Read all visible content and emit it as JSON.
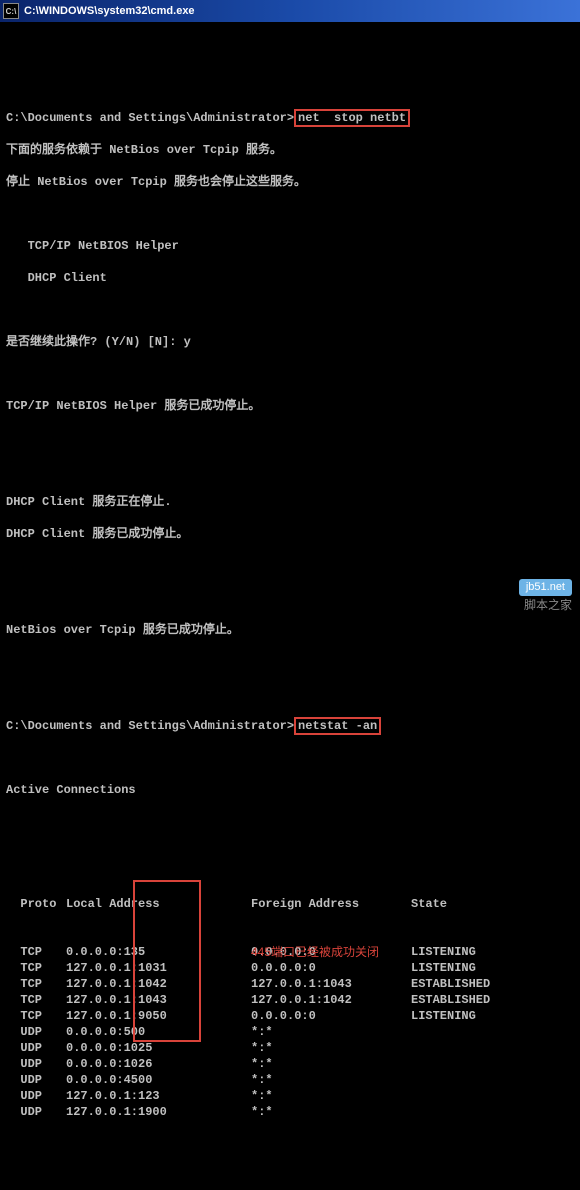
{
  "window": {
    "title": "C:\\WINDOWS\\system32\\cmd.exe",
    "icon_name": "cmd-icon",
    "icon_glyph": "C:\\"
  },
  "lines": {
    "blank": " ",
    "prompt1_path": "C:\\Documents and Settings\\Administrator>",
    "prompt1_cmd": "net  stop netbt",
    "l2": "下面的服务依赖于 NetBios over Tcpip 服务。",
    "l3": "停止 NetBios over Tcpip 服务也会停止这些服务。",
    "l4": "   TCP/IP NetBIOS Helper",
    "l5": "   DHCP Client",
    "l6": "是否继续此操作? (Y/N) [N]: y",
    "l7": "TCP/IP NetBIOS Helper 服务已成功停止。",
    "l8": "DHCP Client 服务正在停止.",
    "l9": "DHCP Client 服务已成功停止。",
    "l10": "NetBios over Tcpip 服务已成功停止。",
    "prompt2_path": "C:\\Documents and Settings\\Administrator>",
    "prompt2_cmd": "netstat -an",
    "l11": "Active Connections",
    "hdr_proto": "Proto",
    "hdr_local": "Local Address",
    "hdr_foreign": "Foreign Address",
    "hdr_state": "State"
  },
  "connections": [
    {
      "proto": "TCP",
      "local": "0.0.0.0:135",
      "foreign": "0.0.0.0:0",
      "state": "LISTENING"
    },
    {
      "proto": "TCP",
      "local": "127.0.0.1:1031",
      "foreign": "0.0.0.0:0",
      "state": "LISTENING"
    },
    {
      "proto": "TCP",
      "local": "127.0.0.1:1042",
      "foreign": "127.0.0.1:1043",
      "state": "ESTABLISHED"
    },
    {
      "proto": "TCP",
      "local": "127.0.0.1:1043",
      "foreign": "127.0.0.1:1042",
      "state": "ESTABLISHED"
    },
    {
      "proto": "TCP",
      "local": "127.0.0.1:9050",
      "foreign": "0.0.0.0:0",
      "state": "LISTENING"
    },
    {
      "proto": "UDP",
      "local": "0.0.0.0:500",
      "foreign": "*:*",
      "state": ""
    },
    {
      "proto": "UDP",
      "local": "0.0.0.0:1025",
      "foreign": "*:*",
      "state": ""
    },
    {
      "proto": "UDP",
      "local": "0.0.0.0:1026",
      "foreign": "*:*",
      "state": ""
    },
    {
      "proto": "UDP",
      "local": "0.0.0.0:4500",
      "foreign": "*:*",
      "state": ""
    },
    {
      "proto": "UDP",
      "local": "127.0.0.1:123",
      "foreign": "*:*",
      "state": ""
    },
    {
      "proto": "UDP",
      "local": "127.0.0.1:1900",
      "foreign": "*:*",
      "state": ""
    }
  ],
  "annotation": "445端口已经被成功关闭",
  "watermark": {
    "url": "jb51.net",
    "site": "脚本之家"
  }
}
